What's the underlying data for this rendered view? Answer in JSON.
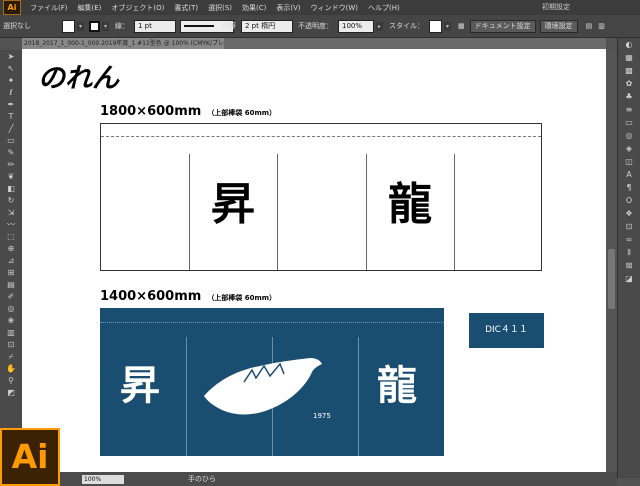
{
  "app": {
    "logo": "Ai",
    "workspace": "初期設定"
  },
  "menu": [
    "ファイル(F)",
    "編集(E)",
    "オブジェクト(O)",
    "書式(T)",
    "選択(S)",
    "効果(C)",
    "表示(V)",
    "ウィンドウ(W)",
    "ヘルプ(H)"
  ],
  "control": {
    "selection": "選択なし",
    "stroke_label": "線：",
    "stroke_value": "1 pt",
    "profile_label": "均等",
    "brush_value": "2 pt 楕円",
    "opacity_label": "不透明度：",
    "opacity_value": "100%",
    "style_label": "スタイル：",
    "doc_settings": "ドキュメント設定",
    "prefs": "環境設定"
  },
  "doc_tab": "2018_2017_1_000-1_000 2019年度_1 #11型色 @ 100% (CMYK/プレビュー)",
  "artboard": {
    "title": "のれん",
    "noren1": {
      "size": "1800×600mm",
      "note": "（上部棒袋 60mm）",
      "char_left": "昇",
      "char_right": "龍"
    },
    "noren2": {
      "size": "1400×600mm",
      "note": "（上部棒袋 60mm）",
      "char_left": "昇",
      "char_right": "龍",
      "year": "1975"
    },
    "dic": "DIC４１１"
  },
  "status": {
    "zoom": "100%",
    "tool": "手のひら"
  },
  "colors": {
    "noren_blue": "#1a4e71",
    "ai_orange": "#ff9a00"
  },
  "icons": {
    "tools": [
      "selection-tool-icon",
      "direct-selection-icon",
      "magic-wand-icon",
      "lasso-icon",
      "pen-icon",
      "type-icon",
      "line-icon",
      "rectangle-icon",
      "paintbrush-icon",
      "pencil-icon",
      "blob-brush-icon",
      "eraser-icon",
      "rotate-icon",
      "scale-icon",
      "warp-icon",
      "free-transform-icon",
      "shape-builder-icon",
      "perspective-icon",
      "mesh-icon",
      "gradient-icon",
      "eyedropper-icon",
      "blend-icon",
      "symbol-sprayer-icon",
      "graph-icon",
      "artboard-icon",
      "slice-icon",
      "hand-icon",
      "zoom-icon",
      "fill-stroke-icon"
    ],
    "panels": [
      "color-panel-icon",
      "color-guide-icon",
      "swatches-icon",
      "brushes-icon",
      "symbols-icon",
      "stroke-icon",
      "gradient-panel-icon",
      "transparency-icon",
      "appearance-icon",
      "graphic-styles-icon",
      "character-icon",
      "paragraph-icon",
      "opentype-icon",
      "layers-icon",
      "artboards-icon",
      "links-icon",
      "align-icon",
      "transform-icon",
      "pathfinder-icon"
    ]
  }
}
